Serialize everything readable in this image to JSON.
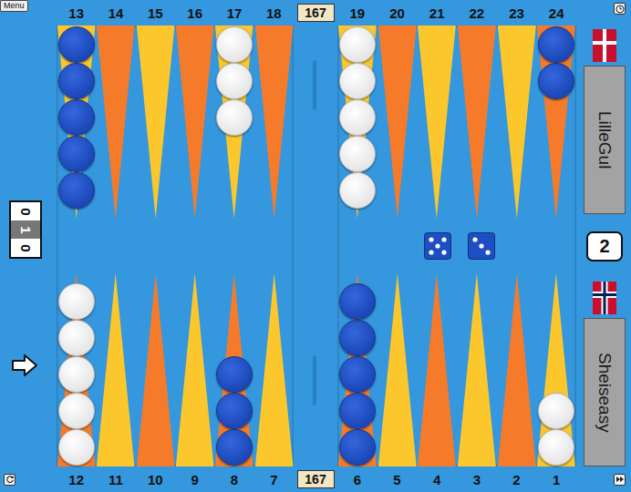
{
  "menu": {
    "label": "Menu"
  },
  "pip_counts": {
    "top": "167",
    "bottom": "167"
  },
  "board": {
    "top_left": [
      {
        "number": "13",
        "color": "#fcc72c",
        "checkers": 5,
        "player": "blue"
      },
      {
        "number": "14",
        "color": "#f57b2b",
        "checkers": 0,
        "player": "none"
      },
      {
        "number": "15",
        "color": "#fcc72c",
        "checkers": 0,
        "player": "none"
      },
      {
        "number": "16",
        "color": "#f57b2b",
        "checkers": 0,
        "player": "none"
      },
      {
        "number": "17",
        "color": "#fcc72c",
        "checkers": 3,
        "player": "white"
      },
      {
        "number": "18",
        "color": "#f57b2b",
        "checkers": 0,
        "player": "none"
      }
    ],
    "top_right": [
      {
        "number": "19",
        "color": "#fcc72c",
        "checkers": 5,
        "player": "white"
      },
      {
        "number": "20",
        "color": "#f57b2b",
        "checkers": 0,
        "player": "none"
      },
      {
        "number": "21",
        "color": "#fcc72c",
        "checkers": 0,
        "player": "none"
      },
      {
        "number": "22",
        "color": "#f57b2b",
        "checkers": 0,
        "player": "none"
      },
      {
        "number": "23",
        "color": "#fcc72c",
        "checkers": 0,
        "player": "none"
      },
      {
        "number": "24",
        "color": "#f57b2b",
        "checkers": 2,
        "player": "blue"
      }
    ],
    "bottom_left": [
      {
        "number": "12",
        "color": "#f57b2b",
        "checkers": 5,
        "player": "white"
      },
      {
        "number": "11",
        "color": "#fcc72c",
        "checkers": 0,
        "player": "none"
      },
      {
        "number": "10",
        "color": "#f57b2b",
        "checkers": 0,
        "player": "none"
      },
      {
        "number": "9",
        "color": "#fcc72c",
        "checkers": 0,
        "player": "none"
      },
      {
        "number": "8",
        "color": "#f57b2b",
        "checkers": 3,
        "player": "blue"
      },
      {
        "number": "7",
        "color": "#fcc72c",
        "checkers": 0,
        "player": "none"
      }
    ],
    "bottom_right": [
      {
        "number": "6",
        "color": "#f57b2b",
        "checkers": 5,
        "player": "blue"
      },
      {
        "number": "5",
        "color": "#fcc72c",
        "checkers": 0,
        "player": "none"
      },
      {
        "number": "4",
        "color": "#f57b2b",
        "checkers": 0,
        "player": "none"
      },
      {
        "number": "3",
        "color": "#fcc72c",
        "checkers": 0,
        "player": "none"
      },
      {
        "number": "2",
        "color": "#f57b2b",
        "checkers": 0,
        "player": "none"
      },
      {
        "number": "1",
        "color": "#fcc72c",
        "checkers": 2,
        "player": "white"
      }
    ]
  },
  "dice": [
    {
      "value": 5
    },
    {
      "value": 3
    }
  ],
  "score": {
    "top": "0",
    "middle": "1",
    "bottom": "0"
  },
  "turn": "bottom",
  "cube": {
    "value": "2"
  },
  "players": [
    {
      "name": "LilleGul",
      "flag": "dk"
    },
    {
      "name": "Sheiseasy",
      "flag": "no"
    }
  ]
}
